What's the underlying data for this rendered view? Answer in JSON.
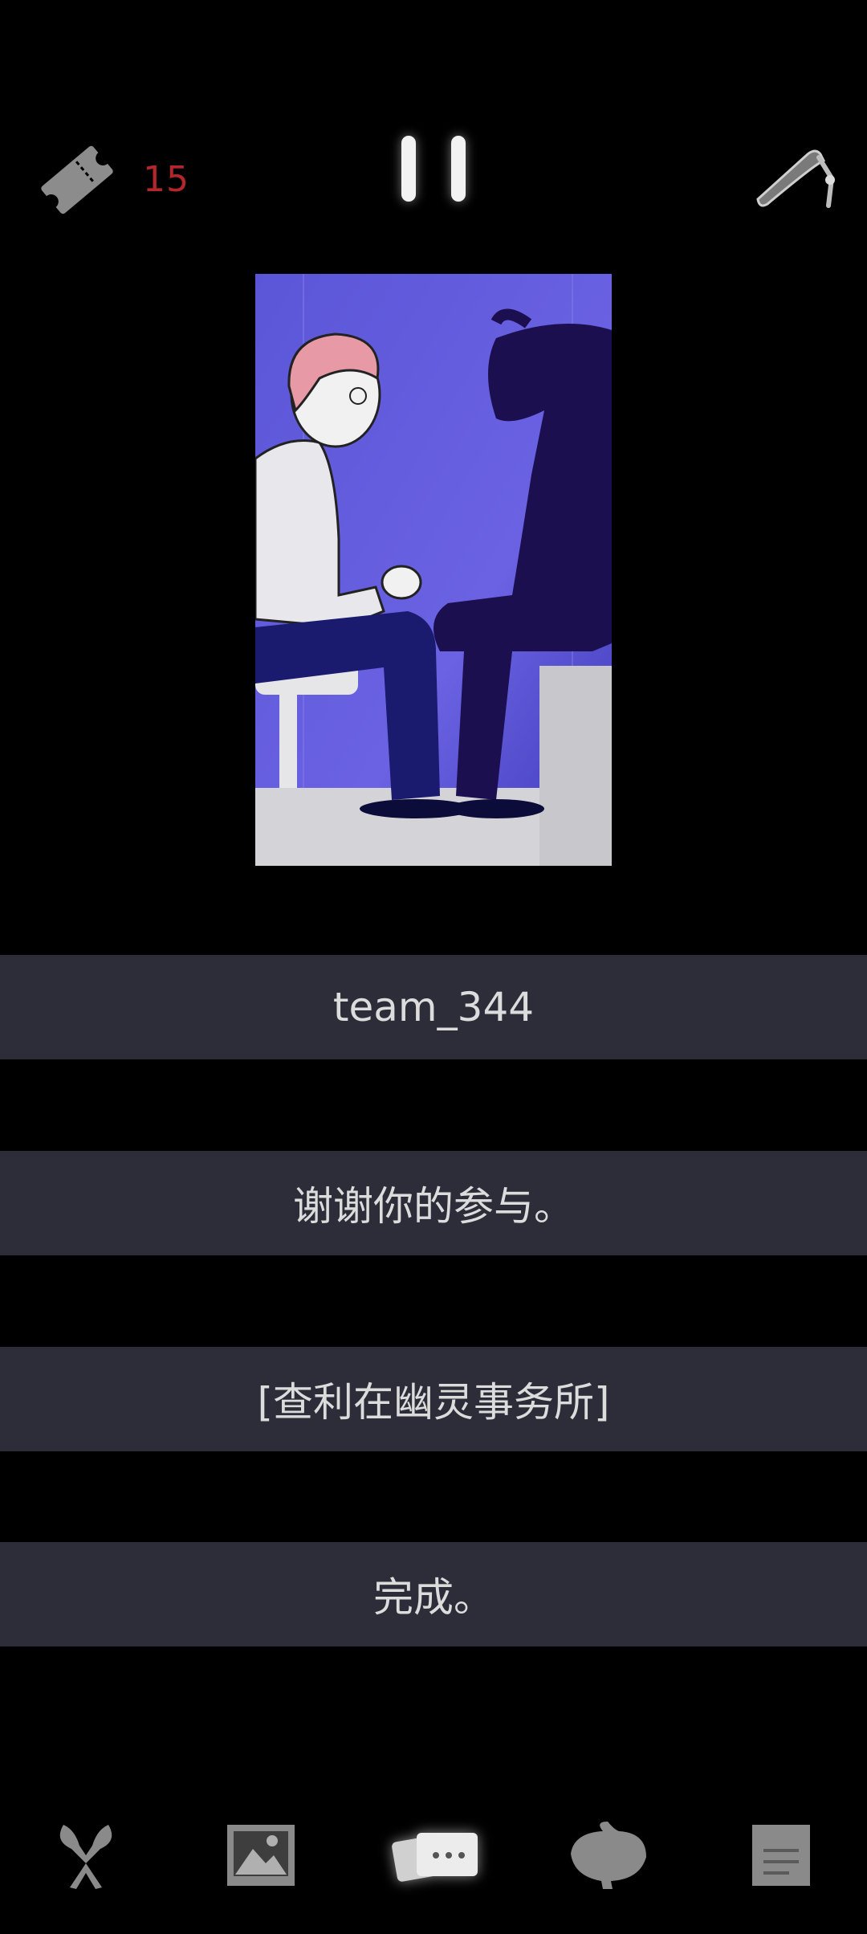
{
  "header": {
    "ticket_count": "15"
  },
  "dialogue": {
    "options": [
      "team_344",
      "谢谢你的参与。",
      "[查利在幽灵事务所]",
      "完成。"
    ]
  },
  "bottom_nav": {
    "items": [
      {
        "icon": "scissors-icon"
      },
      {
        "icon": "gallery-icon"
      },
      {
        "icon": "chat-cards-icon",
        "active": true
      },
      {
        "icon": "creature-icon"
      },
      {
        "icon": "notes-icon"
      }
    ]
  },
  "colors": {
    "background": "#000000",
    "choice_bg": "#2d2d3a",
    "choice_text": "#dcdcdc",
    "ticket_count": "#b3262b",
    "icon_gray": "#8a8a8a",
    "scene_bg": "#5a55d6"
  }
}
